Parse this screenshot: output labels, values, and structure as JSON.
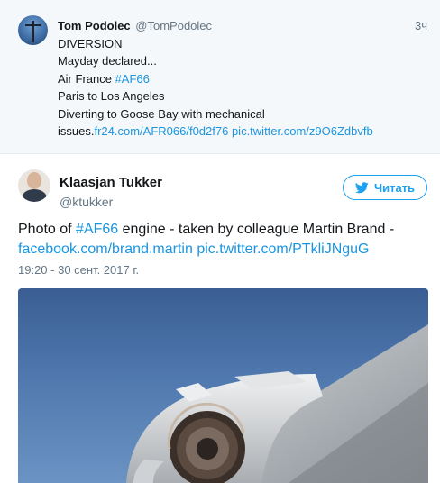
{
  "tweet1": {
    "name": "Tom Podolec",
    "handle": "@TomPodolec",
    "time": "3ч",
    "lines": {
      "l1": "DIVERSION",
      "l2": "Mayday declared...",
      "l3_prefix": "Air France ",
      "l3_hashtag": "#AF66",
      "l4": "Paris to Los Angeles",
      "l5": "Diverting to Goose Bay with mechanical",
      "l6_prefix": "issues.",
      "l6_link1": "fr24.com/AFR066/f0d2f76",
      "l6_link2": "pic.twitter.com/z9O6Zdbvfb"
    }
  },
  "tweet2": {
    "name": "Klaasjan Tukker",
    "handle": "@ktukker",
    "follow_label": "Читать",
    "text_prefix": "Photo of ",
    "hashtag": "#AF66",
    "text_mid": " engine - taken by colleague Martin Brand - ",
    "link1": "facebook.com/brand.martin",
    "link2": "pic.twitter.com/PTkliJNguG",
    "date": "19:20 - 30 сент. 2017 г."
  },
  "colors": {
    "link": "#1b95e0",
    "accent": "#1da1f2",
    "secondary_text": "#657786",
    "highlight_bg": "#f5f8fa"
  },
  "icons": {
    "follow": "twitter-bird-icon"
  }
}
